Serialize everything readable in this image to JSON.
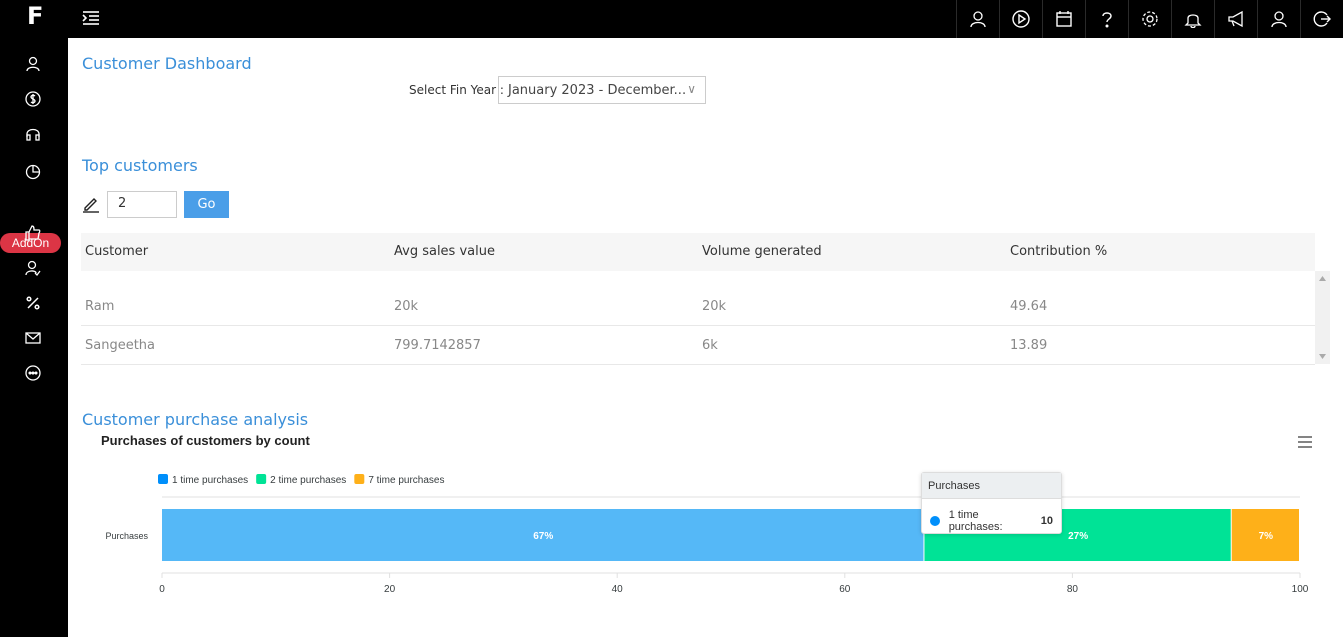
{
  "header": {
    "logo": "F",
    "icons": [
      "user-icon",
      "play-circle-icon",
      "calendar-icon",
      "help-icon",
      "settings-icon",
      "bell-icon",
      "megaphone-icon",
      "profile-icon",
      "logout-icon"
    ]
  },
  "sidebar": {
    "icons": [
      "user-icon",
      "dollar-icon",
      "headset-icon",
      "pie-chart-icon",
      "thumbs-up-icon",
      "user-check-icon",
      "percent-icon",
      "mail-icon",
      "more-icon"
    ],
    "addon_label": "AddOn"
  },
  "dashboard": {
    "title": "Customer Dashboard",
    "fin_year_label": "Select Fin Year",
    "fin_year_value": "January 2023 - December..."
  },
  "top_customers": {
    "title": "Top customers",
    "count_value": "2",
    "go_label": "Go",
    "columns": [
      "Customer",
      "Avg sales value",
      "Volume generated",
      "Contribution %"
    ],
    "rows": [
      [
        "Ram",
        "20k",
        "20k",
        "49.64"
      ],
      [
        "Sangeetha",
        "799.7142857",
        "6k",
        "13.89"
      ]
    ]
  },
  "analysis": {
    "title": "Customer purchase analysis"
  },
  "tooltip": {
    "title": "Purchases",
    "label": "1 time purchases:",
    "value": "10"
  },
  "chart_data": {
    "type": "bar",
    "orientation": "horizontal",
    "stacked": true,
    "title": "Purchases of customers by count",
    "categories": [
      "Purchases"
    ],
    "series": [
      {
        "name": "1 time purchases",
        "values": [
          67
        ],
        "color": "#55b8f7",
        "label": "67%"
      },
      {
        "name": "2 time purchases",
        "values": [
          27
        ],
        "color": "#00e396",
        "label": "27%"
      },
      {
        "name": "7 time purchases",
        "values": [
          7
        ],
        "color": "#feb019",
        "label": "7%"
      }
    ],
    "legend_colors": [
      "#008ffb",
      "#00e396",
      "#feb019"
    ],
    "xlim": [
      0,
      100
    ],
    "xticks": [
      "0",
      "20",
      "40",
      "60",
      "80",
      "100"
    ],
    "legend_position": "top-left",
    "grid": false
  }
}
